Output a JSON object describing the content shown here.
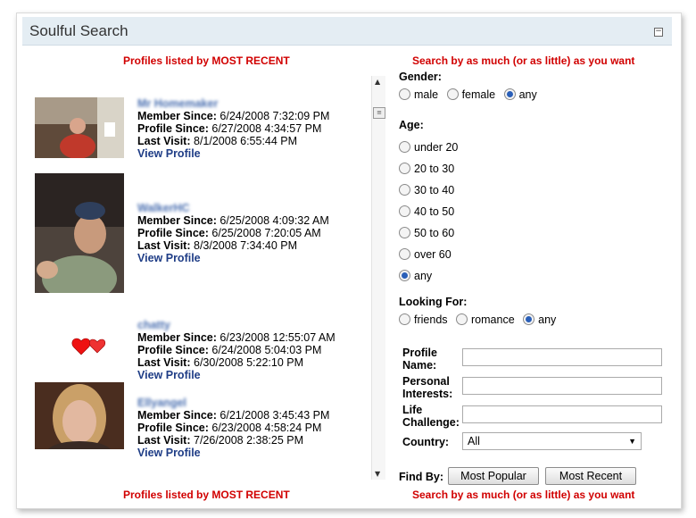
{
  "panel": {
    "title": "Soulful Search",
    "collapse_icon": "minus-box-icon"
  },
  "left": {
    "header_top": "Profiles listed by MOST RECENT",
    "header_bottom": "Profiles listed by MOST RECENT",
    "profiles": [
      {
        "name": "Mr Homemaker",
        "member_since_label": "Member Since:",
        "member_since": "6/24/2008 7:32:09 PM",
        "profile_since_label": "Profile Since:",
        "profile_since": "6/27/2008 4:34:57 PM",
        "last_visit_label": "Last Visit:",
        "last_visit": "8/1/2008 6:55:44 PM",
        "view": "View Profile"
      },
      {
        "name": "WalkerHC",
        "member_since_label": "Member Since:",
        "member_since": "6/25/2008 4:09:32 AM",
        "profile_since_label": "Profile Since:",
        "profile_since": "6/25/2008 7:20:05 AM",
        "last_visit_label": "Last Visit:",
        "last_visit": "8/3/2008 7:34:40 PM",
        "view": "View Profile"
      },
      {
        "name": "chatty",
        "member_since_label": "Member Since:",
        "member_since": "6/23/2008 12:55:07 AM",
        "profile_since_label": "Profile Since:",
        "profile_since": "6/24/2008 5:04:03 PM",
        "last_visit_label": "Last Visit:",
        "last_visit": "6/30/2008 5:22:10 PM",
        "view": "View Profile"
      },
      {
        "name": "Ellyangel",
        "member_since_label": "Member Since:",
        "member_since": "6/21/2008 3:45:43 PM",
        "profile_since_label": "Profile Since:",
        "profile_since": "6/23/2008 4:58:24 PM",
        "last_visit_label": "Last Visit:",
        "last_visit": "7/26/2008 2:38:25 PM",
        "view": "View Profile"
      }
    ]
  },
  "right": {
    "header_top": "Search by as much (or as little) as you want",
    "header_bottom": "Search by as much (or as little) as you want",
    "gender": {
      "label": "Gender:",
      "options": [
        "male",
        "female",
        "any"
      ],
      "selected": "any"
    },
    "age": {
      "label": "Age:",
      "options": [
        "under 20",
        "20 to 30",
        "30 to 40",
        "40 to 50",
        "50 to 60",
        "over 60",
        "any"
      ],
      "selected": "any"
    },
    "looking_for": {
      "label": "Looking For:",
      "options": [
        "friends",
        "romance",
        "any"
      ],
      "selected": "any"
    },
    "fields": {
      "profile_name_1": "Profile",
      "profile_name_2": "Name:",
      "profile_name_value": "",
      "interests_1": "Personal",
      "interests_2": "Interests:",
      "interests_value": "",
      "challenge_1": "Life",
      "challenge_2": "Challenge:",
      "challenge_value": ""
    },
    "country": {
      "label": "Country:",
      "value": "All"
    },
    "find_by": {
      "label": "Find By:",
      "popular": "Most Popular",
      "recent": "Most Recent"
    }
  },
  "colors": {
    "accent_red": "#d10000",
    "link_blue": "#1f3d86",
    "titlebar": "#e4edf3"
  }
}
